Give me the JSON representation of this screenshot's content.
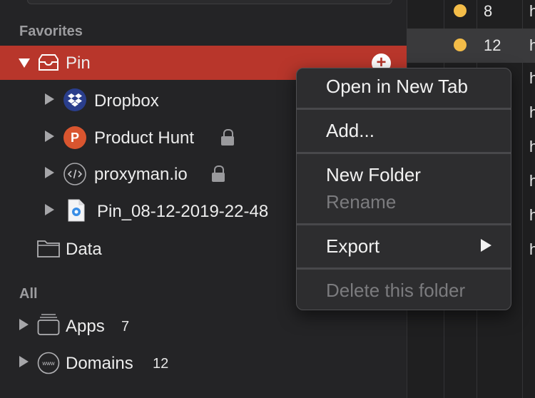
{
  "sidebar": {
    "favorites_header": "Favorites",
    "all_header": "All",
    "pin": {
      "label": "Pin"
    },
    "favorites": [
      {
        "label": "Dropbox",
        "icon": "dropbox-icon",
        "locked": false
      },
      {
        "label": "Product Hunt",
        "icon": "product-hunt-icon",
        "locked": true
      },
      {
        "label": "proxyman.io",
        "icon": "code-icon",
        "locked": true
      },
      {
        "label": "Pin_08-12-2019-22-48",
        "icon": "file-icon",
        "locked": false
      }
    ],
    "data_folder": {
      "label": "Data"
    },
    "all_items": [
      {
        "label": "Apps",
        "count": "7"
      },
      {
        "label": "Domains",
        "count": "12"
      }
    ]
  },
  "table": {
    "rows": [
      {
        "value": "8",
        "cut": "h"
      },
      {
        "value": "12",
        "cut": "h"
      },
      {
        "value": "",
        "cut": "h"
      },
      {
        "value": "",
        "cut": "h"
      },
      {
        "value": "",
        "cut": "h"
      },
      {
        "value": "",
        "cut": "h"
      },
      {
        "value": "",
        "cut": "h"
      },
      {
        "value": "",
        "cut": "h"
      }
    ],
    "dot_color": "#f3bc48"
  },
  "context_menu": {
    "open_new_tab": "Open in New Tab",
    "add": "Add...",
    "new_folder": "New Folder",
    "rename": "Rename",
    "export": "Export",
    "delete_folder": "Delete this folder"
  },
  "colors": {
    "selection": "#b8362b",
    "sidebar_bg": "#242426",
    "menu_bg": "#2d2d2f"
  }
}
